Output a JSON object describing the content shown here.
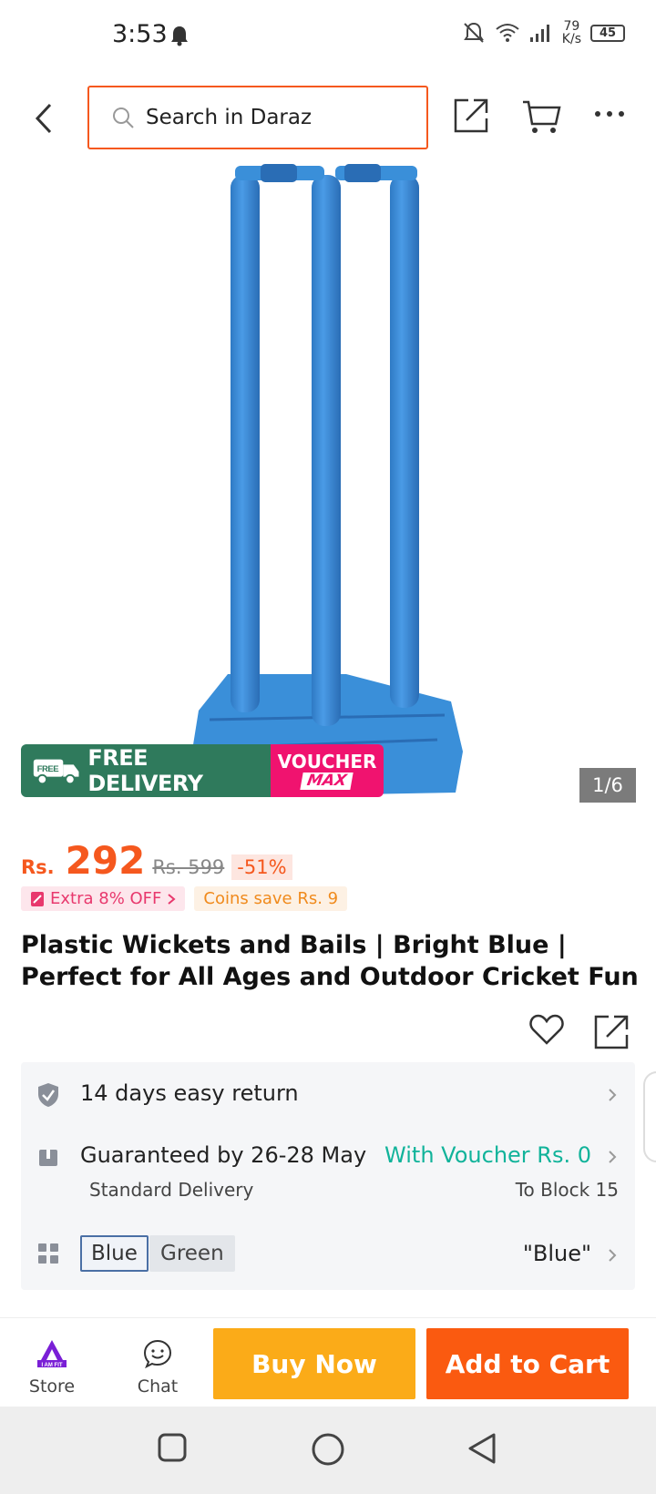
{
  "status_bar": {
    "time": "3:53",
    "net_speed_value": "79",
    "net_speed_unit": "K/s",
    "battery": "45"
  },
  "search": {
    "placeholder": "Search in Daraz"
  },
  "product": {
    "image_counter": "1/6",
    "promo_free_delivery": "FREE DELIVERY",
    "promo_free_small": "FREE",
    "promo_voucher_line1": "VOUCHER",
    "promo_voucher_line2": "MAX",
    "product_color": "#3a8fd9",
    "price_currency": "Rs.",
    "price": "292",
    "original_price": "Rs. 599",
    "discount": "-51%",
    "extra_off": "Extra 8% OFF",
    "coins_save": "Coins save Rs. 9",
    "title": "Plastic Wickets and Bails | Bright Blue | Perfect for All Ages and Outdoor Cricket Fun"
  },
  "info": {
    "return_policy": "14 days easy return",
    "delivery_guarantee": "Guaranteed by 26-28 May",
    "voucher_text": "With Voucher Rs. 0",
    "delivery_type": "Standard Delivery",
    "delivery_location": "To Block 15",
    "color_options": [
      "Blue",
      "Green"
    ],
    "selected_color": "\"Blue\""
  },
  "action_bar": {
    "store_logo": "I AM FIT",
    "store_label": "Store",
    "chat_label": "Chat",
    "buy_now": "Buy Now",
    "add_to_cart": "Add to Cart"
  },
  "colors": {
    "brand_orange": "#f5581e",
    "buy_now": "#fbab18",
    "add_to_cart": "#fa5a10",
    "voucher_green": "#11b39a"
  }
}
